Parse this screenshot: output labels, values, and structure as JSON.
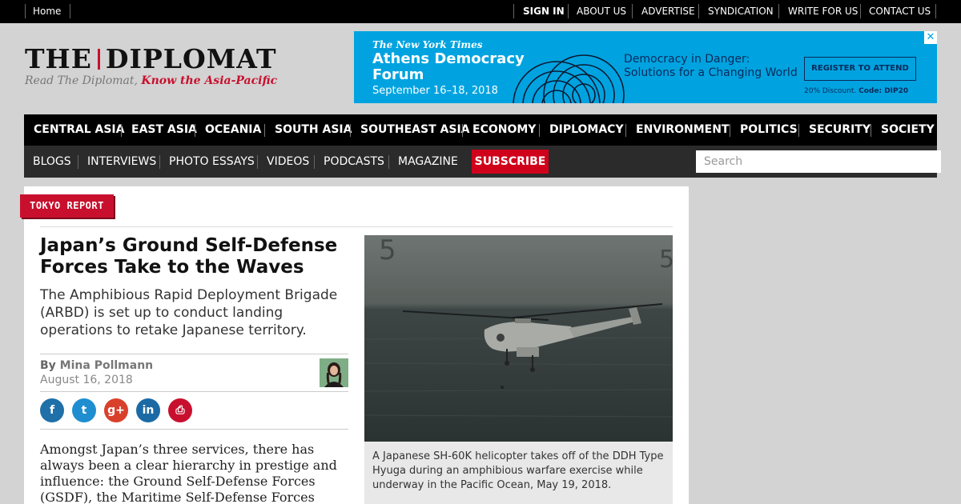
{
  "topbar": {
    "home": "Home",
    "sign_in": "SIGN IN",
    "about": "ABOUT US",
    "advertise": "ADVERTISE",
    "syndication": "SYNDICATION",
    "write": "WRITE FOR US",
    "contact": "CONTACT US"
  },
  "logo": {
    "left": "THE",
    "right": "DIPLOMAT",
    "tagline_plain": "Read The Diplomat, ",
    "tagline_bold": "Know the Asia-Pacific"
  },
  "ad": {
    "brand": "The New York Times",
    "title_line1": "Athens Democracy",
    "title_line2": "Forum",
    "dates": "September 16–18, 2018",
    "tagline_line1": "Democracy in Danger:",
    "tagline_line2": "Solutions for a Changing World",
    "cta": "REGISTER TO ATTEND",
    "discount": "20% Discount.",
    "code": "Code: DIP20",
    "close": "✕",
    "bg_color": "#00a3e0"
  },
  "nav_primary": [
    "CENTRAL ASIA",
    "EAST ASIA",
    "OCEANIA",
    "SOUTH ASIA",
    "SOUTHEAST ASIA",
    "ECONOMY",
    "DIPLOMACY",
    "ENVIRONMENT",
    "POLITICS",
    "SECURITY",
    "SOCIETY"
  ],
  "nav_secondary": [
    "BLOGS",
    "INTERVIEWS",
    "PHOTO ESSAYS",
    "VIDEOS",
    "PODCASTS",
    "MAGAZINE"
  ],
  "subscribe": "SUBSCRIBE",
  "search": {
    "placeholder": "Search"
  },
  "article": {
    "kicker": "TOKYO REPORT",
    "headline": "Japan’s Ground Self-Defense Forces Take to the Waves",
    "dek": "The Amphibious Rapid Deployment Brigade (ARBD) is set up to conduct landing operations to retake Japanese territory.",
    "byline_prefix": "By ",
    "author": "Mina Pollmann",
    "date": "August 16, 2018",
    "body": "Amongst Japan’s three services, there has always been a clear hierarchy in prestige and influence: the Ground Self-Defense Forces (GSDF), the Maritime Self-Defense Forces",
    "caption": "A Japanese SH-60K helicopter takes off of the DDH Type Hyuga during an amphibious warfare exercise while underway in the Pacific Ocean, May 19, 2018."
  },
  "share_icons": [
    {
      "name": "facebook-icon",
      "glyph": "f",
      "color": "#1f6fa8"
    },
    {
      "name": "twitter-icon",
      "glyph": "t",
      "color": "#1f8ed0"
    },
    {
      "name": "google-plus-icon",
      "glyph": "g+",
      "color": "#d9402b"
    },
    {
      "name": "linkedin-icon",
      "glyph": "in",
      "color": "#1b6aa5"
    },
    {
      "name": "print-icon",
      "glyph": "⎙",
      "color": "#c8102e"
    }
  ],
  "colors": {
    "brand_red": "#c8102e",
    "nav_black": "#000000",
    "nav_gray": "#2b2b2b"
  }
}
